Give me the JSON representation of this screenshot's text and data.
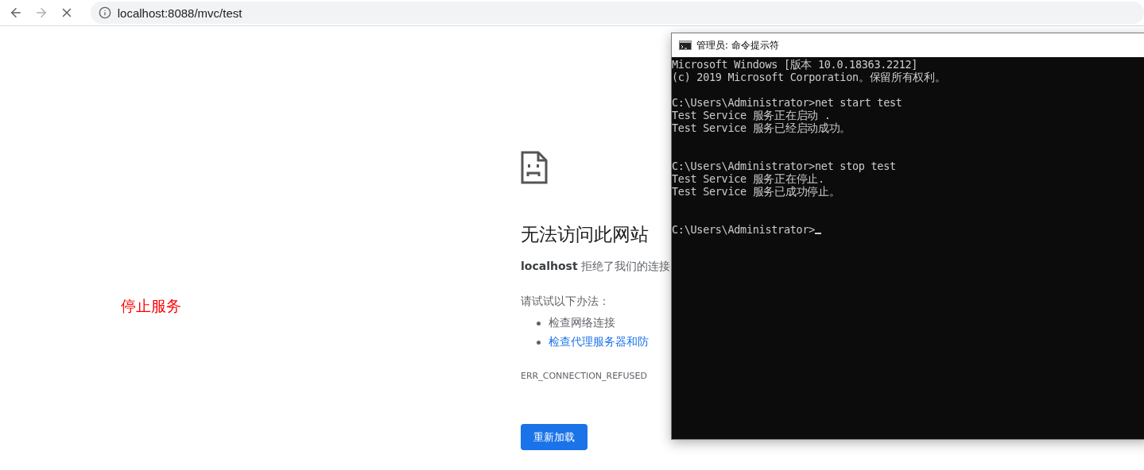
{
  "browser": {
    "nav_buttons": [
      {
        "kind": "back",
        "disabled": false
      },
      {
        "kind": "forward",
        "disabled": true
      },
      {
        "kind": "stop",
        "disabled": false
      }
    ],
    "address": "localhost:8088/mvc/test"
  },
  "annotation": {
    "text": "停止服务",
    "color": "#ff0000"
  },
  "error_page": {
    "title": "无法访问此网站",
    "message": "**localhost** 拒绝了我们的连接",
    "suggestions_heading": "请试试以下办法：",
    "suggestions": [
      {
        "text": "检查网络连接",
        "link": false
      },
      {
        "text": "检查代理服务器和防",
        "link": true
      }
    ],
    "error_code": "ERR_CONNECTION_REFUSED",
    "reload_button": "重新加载"
  },
  "console_window": {
    "title": "管理员: 命令提示符",
    "lines": [
      {
        "kind": "text",
        "text": "Microsoft Windows [版本 10.0.18363.2212]"
      },
      {
        "kind": "text",
        "text": "(c) 2019 Microsoft Corporation。保留所有权利。"
      },
      {
        "kind": "blank"
      },
      {
        "kind": "text",
        "text": "C:\\Users\\Administrator>net start test"
      },
      {
        "kind": "text",
        "text": "Test Service 服务正在启动 ."
      },
      {
        "kind": "text",
        "text": "Test Service 服务已经启动成功。"
      },
      {
        "kind": "blank"
      },
      {
        "kind": "blank"
      },
      {
        "kind": "text",
        "text": "C:\\Users\\Administrator>net stop test"
      },
      {
        "kind": "text",
        "text": "Test Service 服务正在停止."
      },
      {
        "kind": "text",
        "text": "Test Service 服务已成功停止。"
      },
      {
        "kind": "blank"
      },
      {
        "kind": "blank"
      },
      {
        "kind": "prompt",
        "text": "C:\\Users\\Administrator>"
      }
    ]
  }
}
